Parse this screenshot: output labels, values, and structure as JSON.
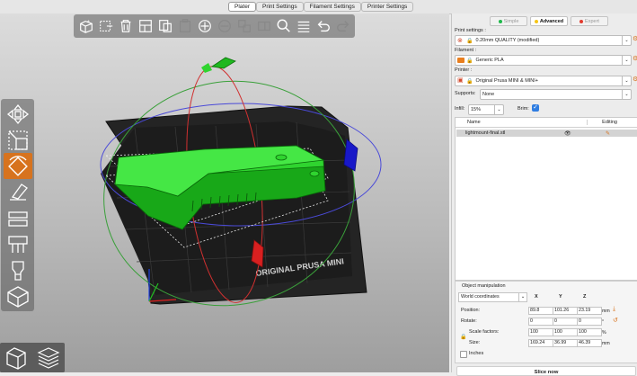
{
  "tabs": [
    {
      "label": "Plater",
      "active": true
    },
    {
      "label": "Print Settings",
      "active": false
    },
    {
      "label": "Filament Settings",
      "active": false
    },
    {
      "label": "Printer Settings",
      "active": false
    }
  ],
  "top_toolbar": {
    "icons": [
      "add-object-icon",
      "delete-icon",
      "delete-all-icon",
      "arrange-icon",
      "copy-icon",
      "paste-icon",
      "add-instance-icon",
      "remove-instance-icon",
      "split-objects-icon",
      "split-parts-icon",
      "search-icon",
      "layers-editing-icon",
      "undo-icon",
      "redo-icon"
    ]
  },
  "left_toolbar": {
    "icons": [
      "move-icon",
      "scale-icon",
      "rotate-icon",
      "place-on-face-icon",
      "cut-icon",
      "support-painting-icon",
      "seam-painting-icon",
      "hollow-icon"
    ],
    "active": "rotate-icon"
  },
  "bed_label": "ORIGINAL PRUSA MINI",
  "modes": [
    {
      "label": "Simple",
      "color": "#1fb84a",
      "active": false
    },
    {
      "label": "Advanced",
      "color": "#f5c518",
      "active": true
    },
    {
      "label": "Expert",
      "color": "#e23b2e",
      "active": false
    }
  ],
  "print_settings": {
    "label": "Print settings :",
    "value": "0.20mm QUALITY (modified)"
  },
  "filament": {
    "label": "Filament :",
    "value": "Generic PLA",
    "color": "#e87e1e"
  },
  "printer": {
    "label": "Printer :",
    "value": "Original Prusa MINI & MINI+"
  },
  "supports": {
    "label": "Supports:",
    "value": "None"
  },
  "infill": {
    "label": "Infill:",
    "value": "15%"
  },
  "brim": {
    "label": "Brim:",
    "checked": true
  },
  "object_list": {
    "col_name": "Name",
    "col_editing": "Editing",
    "items": [
      {
        "name": "lightmount-final.stl"
      }
    ]
  },
  "object_manipulation": {
    "title": "Object manipulation",
    "coord_system": "World coordinates",
    "axes": [
      "X",
      "Y",
      "Z"
    ],
    "position": {
      "label": "Position:",
      "values": [
        "89.8",
        "101.26",
        "23.19"
      ],
      "unit": "mm"
    },
    "rotate": {
      "label": "Rotate:",
      "values": [
        "0",
        "0",
        "0"
      ],
      "unit": "°"
    },
    "scale": {
      "label": "Scale factors:",
      "values": [
        "100",
        "100",
        "100"
      ],
      "unit": "%"
    },
    "size": {
      "label": "Size:",
      "values": [
        "169.24",
        "36.99",
        "46.39"
      ],
      "unit": "mm"
    },
    "inches": {
      "label": "Inches",
      "checked": false
    }
  },
  "slice_button": "Slice now"
}
